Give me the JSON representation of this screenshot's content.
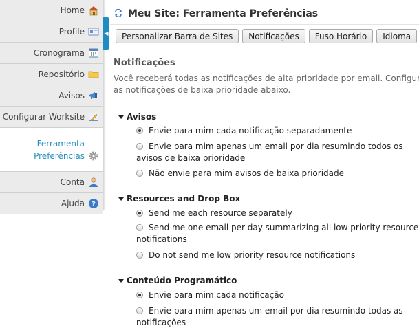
{
  "sidebar": {
    "items": [
      {
        "label": "Home",
        "icon": "home-icon"
      },
      {
        "label": "Profile",
        "icon": "profile-card-icon"
      },
      {
        "label": "Cronograma",
        "icon": "calendar-icon"
      },
      {
        "label": "Repositório",
        "icon": "folder-icon"
      },
      {
        "label": "Avisos",
        "icon": "megaphone-icon"
      },
      {
        "label": "Configurar Worksite",
        "icon": "edit-site-icon"
      },
      {
        "label_line1": "Ferramenta",
        "label_line2": "Preferências",
        "icon": "gear-icon",
        "active": true
      },
      {
        "label": "Conta",
        "icon": "user-icon"
      },
      {
        "label": "Ajuda",
        "icon": "help-icon"
      }
    ]
  },
  "header": {
    "title": "Meu Site: Ferramenta Preferências"
  },
  "tabs": [
    "Personalizar Barra de Sites",
    "Notificações",
    "Fuso Horário",
    "Idioma"
  ],
  "main": {
    "section_title": "Notificações",
    "intro": "Você receberá todas as notificações de alta prioridade por email. Configure as notificações de baixa prioridade abaixo.",
    "groups": [
      {
        "title": "Avisos",
        "options": [
          {
            "label": "Envie para mim cada notificação separadamente",
            "selected": true
          },
          {
            "label": "Envie para mim apenas um email por dia resumindo todos os avisos de baixa prioridade",
            "selected": false
          },
          {
            "label": "Não envie para mim avisos de baixa prioridade",
            "selected": false
          }
        ]
      },
      {
        "title": "Resources and Drop Box",
        "options": [
          {
            "label": "Send me each resource separately",
            "selected": true
          },
          {
            "label": "Send me one email per day summarizing all low priority resource notifications",
            "selected": false
          },
          {
            "label": "Do not send me low priority resource notifications",
            "selected": false
          }
        ]
      },
      {
        "title": "Conteúdo Programático",
        "options": [
          {
            "label": "Envie para mim cada notificação",
            "selected": true
          },
          {
            "label": "Envie para mim apenas um email por dia resumindo todas as notificações",
            "selected": false
          }
        ]
      }
    ]
  },
  "colors": {
    "accent": "#1e8bc3",
    "active_link": "#2a8fc0"
  }
}
